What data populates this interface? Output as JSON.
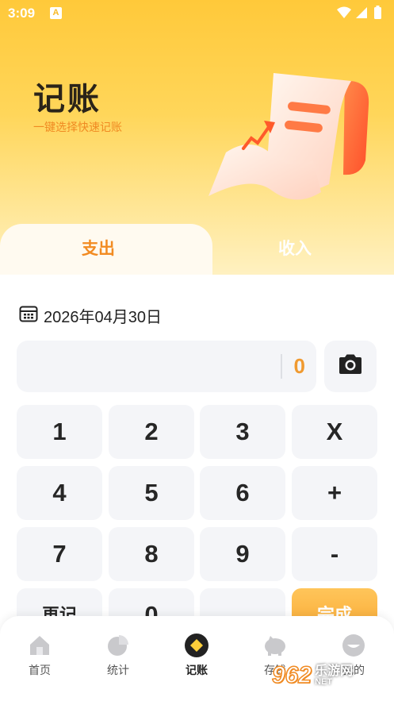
{
  "status_bar": {
    "time": "3:09",
    "notification_badge": "A"
  },
  "hero": {
    "title": "记账",
    "subtitle": "一键选择快速记账"
  },
  "tabs": [
    {
      "label": "支出",
      "active": true
    },
    {
      "label": "收入",
      "active": false
    }
  ],
  "date": {
    "text": "2026年04月30日"
  },
  "amount": {
    "value": "0"
  },
  "keypad": {
    "row1": [
      "1",
      "2",
      "3",
      "X"
    ],
    "row2": [
      "4",
      "5",
      "6",
      "+"
    ],
    "row3": [
      "7",
      "8",
      "9",
      "-"
    ],
    "row4": [
      "再记",
      "0",
      "",
      "完成"
    ]
  },
  "bottom_nav": [
    {
      "label": "首页",
      "icon": "home-icon"
    },
    {
      "label": "统计",
      "icon": "pie-chart-icon"
    },
    {
      "label": "记账",
      "icon": "bookkeeping-icon",
      "active": true
    },
    {
      "label": "存钱",
      "icon": "piggy-bank-icon"
    },
    {
      "label": "我的",
      "icon": "profile-icon"
    }
  ],
  "watermark": {
    "number": "962",
    "brand_cn": "乐游网",
    "brand_en": "NET"
  },
  "colors": {
    "accent": "#f28b22",
    "hero_top": "#ffc93a",
    "key_bg": "#f4f5f8"
  }
}
